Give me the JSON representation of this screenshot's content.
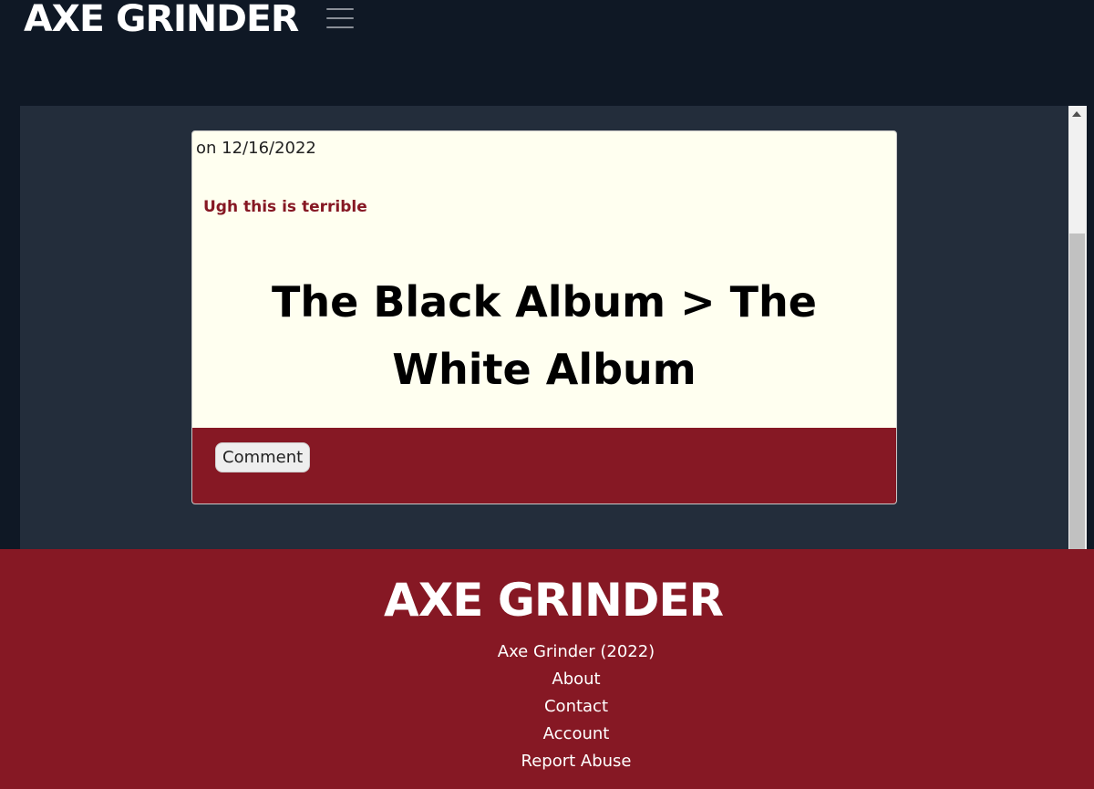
{
  "header": {
    "logo_text": "AXE GRINDER",
    "menu_icon": "hamburger-menu-icon"
  },
  "post": {
    "date": "on 12/16/2022",
    "subtitle": "Ugh this is terrible",
    "title": "The Black Album > The White Album",
    "comment_label": "Comment"
  },
  "footer": {
    "logo_text": "AXE GRINDER",
    "links": [
      "Axe Grinder (2022)",
      "About",
      "Contact",
      "Account",
      "Report Abuse"
    ]
  },
  "colors": {
    "header_bg": "#0f1825",
    "panel_bg": "#232d3b",
    "card_bg": "#fffff0",
    "brand_red": "#861824"
  }
}
